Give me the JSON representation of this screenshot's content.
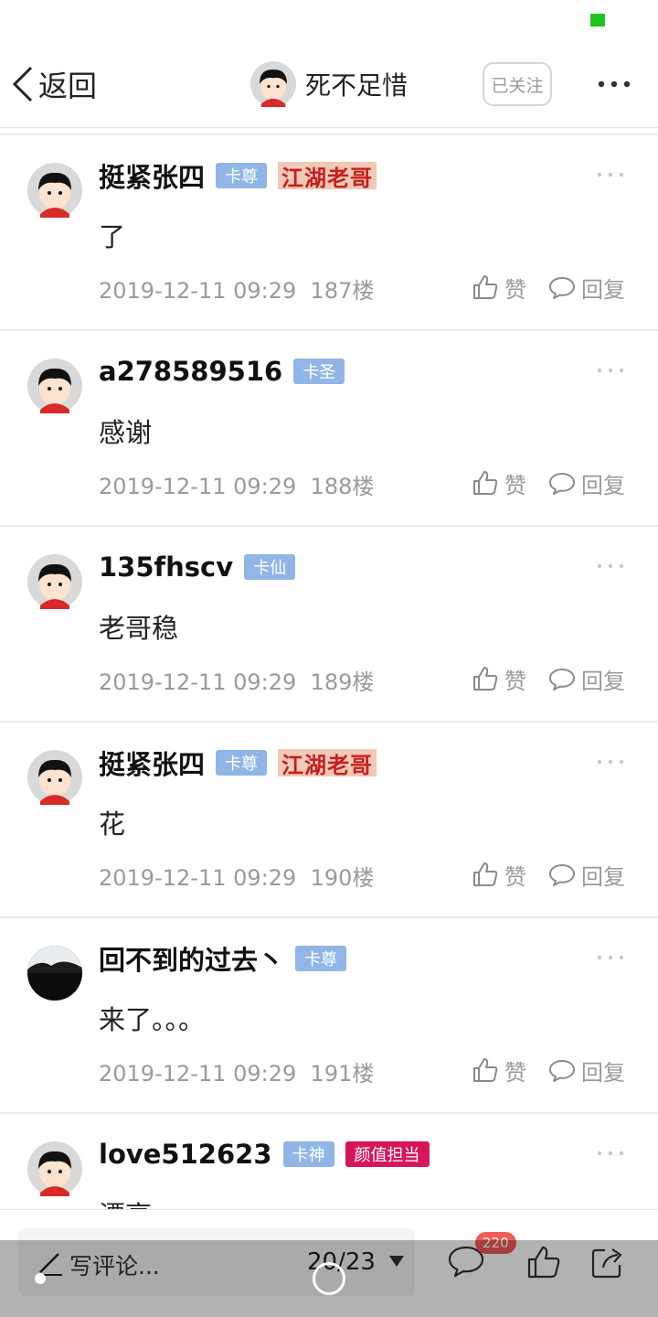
{
  "header": {
    "back_label": "返回",
    "title": "死不足惜",
    "follow_label": "已关注",
    "more_icon": "more-horizontal-icon"
  },
  "posts": [
    {
      "username": "挺紧张四",
      "level_tag": "卡尊",
      "badge": "江湖老哥",
      "extra_tag": "",
      "content": "了",
      "time": "2019-12-11 09:29",
      "floor": "187楼",
      "like_label": "赞",
      "reply_label": "回复",
      "avatar": "default"
    },
    {
      "username": "a278589516",
      "level_tag": "卡圣",
      "badge": "",
      "extra_tag": "",
      "content": "感谢",
      "time": "2019-12-11 09:29",
      "floor": "188楼",
      "like_label": "赞",
      "reply_label": "回复",
      "avatar": "default"
    },
    {
      "username": "135fhscv",
      "level_tag": "卡仙",
      "badge": "",
      "extra_tag": "",
      "content": "老哥稳",
      "time": "2019-12-11 09:29",
      "floor": "189楼",
      "like_label": "赞",
      "reply_label": "回复",
      "avatar": "default"
    },
    {
      "username": "挺紧张四",
      "level_tag": "卡尊",
      "badge": "江湖老哥",
      "extra_tag": "",
      "content": "花",
      "time": "2019-12-11 09:29",
      "floor": "190楼",
      "like_label": "赞",
      "reply_label": "回复",
      "avatar": "default"
    },
    {
      "username": "回不到的过去丶",
      "level_tag": "卡尊",
      "badge": "",
      "extra_tag": "",
      "content": "来了。。。",
      "time": "2019-12-11 09:29",
      "floor": "191楼",
      "like_label": "赞",
      "reply_label": "回复",
      "avatar": "dark-photo"
    },
    {
      "username": "love512623",
      "level_tag": "卡神",
      "badge": "",
      "extra_tag": "颜值担当",
      "content": "漂亮",
      "time": "",
      "floor": "",
      "like_label": "",
      "reply_label": "",
      "avatar": "default"
    }
  ],
  "bottom_bar": {
    "comment_placeholder": "写评论...",
    "page_indicator": "20/23",
    "comment_count": "220"
  },
  "colors": {
    "level_tag_bg": "#91b6e6",
    "pink_tag_bg": "#d6155a",
    "badge_bg": "#f1c9b6",
    "badge_text": "#c41f1f",
    "count_badge": "#f25b55",
    "status_indicator": "#1fc31f"
  }
}
